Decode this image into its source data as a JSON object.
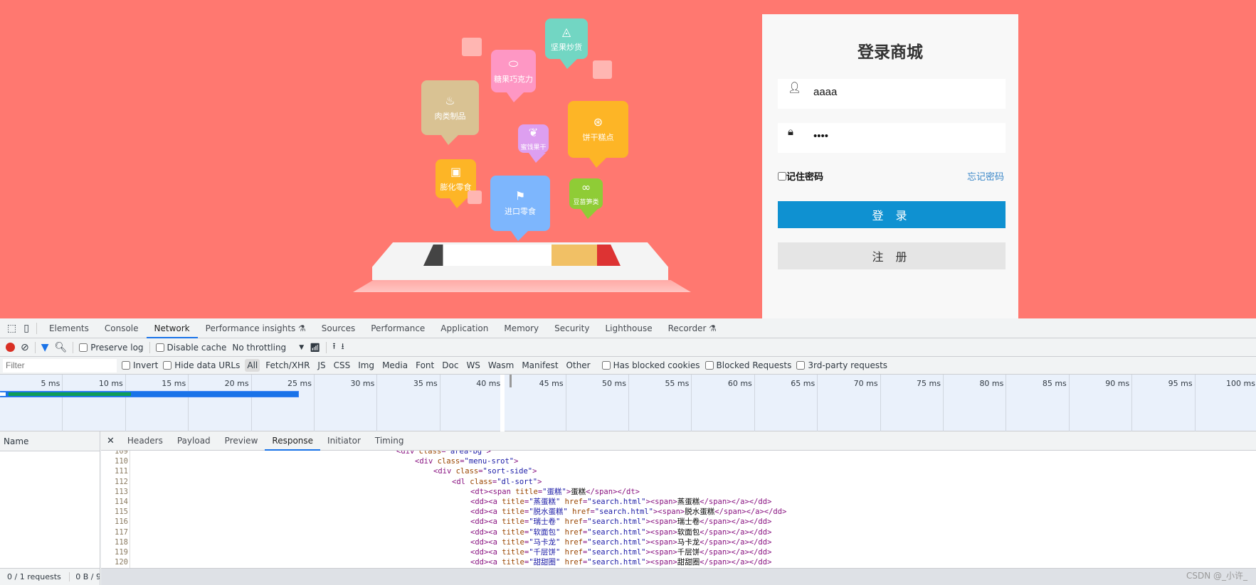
{
  "page": {
    "bg_color": "#ff7870",
    "categories": [
      {
        "label": "坚果炒货",
        "icon": "nut-icon",
        "color": "#72d6c3"
      },
      {
        "label": "糖果巧克力",
        "icon": "candy-icon",
        "color": "#fe97c4"
      },
      {
        "label": "肉类制品",
        "icon": "drumstick-icon",
        "color": "#d9c293"
      },
      {
        "label": "蜜饯果干",
        "icon": "cherry-icon",
        "color": "#dd9ff0"
      },
      {
        "label": "饼干糕点",
        "icon": "cookie-icon",
        "color": "#fdb526"
      },
      {
        "label": "膨化零食",
        "icon": "snack-bag-icon",
        "color": "#fdb526"
      },
      {
        "label": "进口零食",
        "icon": "flag-icon",
        "color": "#7db6fd"
      },
      {
        "label": "豆苗笋类",
        "icon": "sprout-icon",
        "color": "#8fcc36"
      }
    ]
  },
  "login": {
    "title": "登录商城",
    "username": "aaaa",
    "password": "aaaa",
    "remember": "记住密码",
    "forgot": "忘记密码",
    "login_btn": "登 录",
    "register_btn": "注 册",
    "accent": "#0f91d1"
  },
  "devtools": {
    "tabs": [
      "Elements",
      "Console",
      "Network",
      "Performance insights ⚗",
      "Sources",
      "Performance",
      "Application",
      "Memory",
      "Security",
      "Lighthouse",
      "Recorder ⚗"
    ],
    "active_tab": "Network",
    "toolbar": {
      "preserve_log": "Preserve log",
      "disable_cache": "Disable cache",
      "throttling": "No throttling"
    },
    "filter": {
      "placeholder": "Filter",
      "invert": "Invert",
      "hide_data_urls": "Hide data URLs",
      "types": [
        "All",
        "Fetch/XHR",
        "JS",
        "CSS",
        "Img",
        "Media",
        "Font",
        "Doc",
        "WS",
        "Wasm",
        "Manifest",
        "Other"
      ],
      "has_blocked_cookies": "Has blocked cookies",
      "blocked_requests": "Blocked Requests",
      "third_party": "3rd-party requests"
    },
    "timeline_ticks": [
      "5 ms",
      "10 ms",
      "15 ms",
      "20 ms",
      "25 ms",
      "30 ms",
      "35 ms",
      "40 ms",
      "45 ms",
      "50 ms",
      "55 ms",
      "60 ms",
      "65 ms",
      "70 ms",
      "75 ms",
      "80 ms",
      "85 ms",
      "90 ms",
      "95 ms",
      "100 ms"
    ],
    "name_header": "Name",
    "detail_tabs": [
      "Headers",
      "Payload",
      "Preview",
      "Response",
      "Initiator",
      "Timing"
    ],
    "active_detail_tab": "Response",
    "status": {
      "requests": "0 / 1 requests",
      "transferred": "0 B / 9"
    },
    "code_lines": [
      {
        "n": "109",
        "i": 0,
        "t": [
          [
            "tag",
            "<div "
          ],
          [
            "an",
            "class"
          ],
          [
            "tag",
            "="
          ],
          [
            "av",
            "\"area-bg\""
          ],
          [
            "tag",
            ">"
          ]
        ]
      },
      {
        "n": "110",
        "i": 1,
        "t": [
          [
            "tag",
            "<div "
          ],
          [
            "an",
            "class"
          ],
          [
            "tag",
            "="
          ],
          [
            "av",
            "\"menu-srot\""
          ],
          [
            "tag",
            ">"
          ]
        ]
      },
      {
        "n": "111",
        "i": 2,
        "t": [
          [
            "tag",
            "<div "
          ],
          [
            "an",
            "class"
          ],
          [
            "tag",
            "="
          ],
          [
            "av",
            "\"sort-side\""
          ],
          [
            "tag",
            ">"
          ]
        ]
      },
      {
        "n": "112",
        "i": 3,
        "t": [
          [
            "tag",
            "<dl "
          ],
          [
            "an",
            "class"
          ],
          [
            "tag",
            "="
          ],
          [
            "av",
            "\"dl-sort\""
          ],
          [
            "tag",
            ">"
          ]
        ]
      },
      {
        "n": "113",
        "i": 4,
        "t": [
          [
            "tag",
            "<dt><span "
          ],
          [
            "an",
            "title"
          ],
          [
            "tag",
            "="
          ],
          [
            "av",
            "\"蛋糕\""
          ],
          [
            "tag",
            ">"
          ],
          [
            "tx",
            "蛋糕"
          ],
          [
            "tag",
            "</span></dt>"
          ]
        ]
      },
      {
        "n": "114",
        "i": 4,
        "t": [
          [
            "tag",
            "<dd><a "
          ],
          [
            "an",
            "title"
          ],
          [
            "tag",
            "="
          ],
          [
            "av",
            "\"蒸蛋糕\" "
          ],
          [
            "an",
            "href"
          ],
          [
            "tag",
            "="
          ],
          [
            "av",
            "\"search.html\""
          ],
          [
            "tag",
            "><span>"
          ],
          [
            "tx",
            "蒸蛋糕"
          ],
          [
            "tag",
            "</span></a></dd>"
          ]
        ]
      },
      {
        "n": "115",
        "i": 4,
        "t": [
          [
            "tag",
            "<dd><a "
          ],
          [
            "an",
            "title"
          ],
          [
            "tag",
            "="
          ],
          [
            "av",
            "\"脱水蛋糕\" "
          ],
          [
            "an",
            "href"
          ],
          [
            "tag",
            "="
          ],
          [
            "av",
            "\"search.html\""
          ],
          [
            "tag",
            "><span>"
          ],
          [
            "tx",
            "脱水蛋糕"
          ],
          [
            "tag",
            "</span></a></dd>"
          ]
        ]
      },
      {
        "n": "116",
        "i": 4,
        "t": [
          [
            "tag",
            "<dd><a "
          ],
          [
            "an",
            "title"
          ],
          [
            "tag",
            "="
          ],
          [
            "av",
            "\"瑞士卷\" "
          ],
          [
            "an",
            "href"
          ],
          [
            "tag",
            "="
          ],
          [
            "av",
            "\"search.html\""
          ],
          [
            "tag",
            "><span>"
          ],
          [
            "tx",
            "瑞士卷"
          ],
          [
            "tag",
            "</span></a></dd>"
          ]
        ]
      },
      {
        "n": "117",
        "i": 4,
        "t": [
          [
            "tag",
            "<dd><a "
          ],
          [
            "an",
            "title"
          ],
          [
            "tag",
            "="
          ],
          [
            "av",
            "\"软面包\" "
          ],
          [
            "an",
            "href"
          ],
          [
            "tag",
            "="
          ],
          [
            "av",
            "\"search.html\""
          ],
          [
            "tag",
            "><span>"
          ],
          [
            "tx",
            "软面包"
          ],
          [
            "tag",
            "</span></a></dd>"
          ]
        ]
      },
      {
        "n": "118",
        "i": 4,
        "t": [
          [
            "tag",
            "<dd><a "
          ],
          [
            "an",
            "title"
          ],
          [
            "tag",
            "="
          ],
          [
            "av",
            "\"马卡龙\" "
          ],
          [
            "an",
            "href"
          ],
          [
            "tag",
            "="
          ],
          [
            "av",
            "\"search.html\""
          ],
          [
            "tag",
            "><span>"
          ],
          [
            "tx",
            "马卡龙"
          ],
          [
            "tag",
            "</span></a></dd>"
          ]
        ]
      },
      {
        "n": "119",
        "i": 4,
        "t": [
          [
            "tag",
            "<dd><a "
          ],
          [
            "an",
            "title"
          ],
          [
            "tag",
            "="
          ],
          [
            "av",
            "\"千层饼\" "
          ],
          [
            "an",
            "href"
          ],
          [
            "tag",
            "="
          ],
          [
            "av",
            "\"search.html\""
          ],
          [
            "tag",
            "><span>"
          ],
          [
            "tx",
            "千层饼"
          ],
          [
            "tag",
            "</span></a></dd>"
          ]
        ]
      },
      {
        "n": "120",
        "i": 4,
        "t": [
          [
            "tag",
            "<dd><a "
          ],
          [
            "an",
            "title"
          ],
          [
            "tag",
            "="
          ],
          [
            "av",
            "\"甜甜圈\" "
          ],
          [
            "an",
            "href"
          ],
          [
            "tag",
            "="
          ],
          [
            "av",
            "\"search.html\""
          ],
          [
            "tag",
            "><span>"
          ],
          [
            "tx",
            "甜甜圈"
          ],
          [
            "tag",
            "</span></a></dd>"
          ]
        ]
      }
    ]
  },
  "watermark": "CSDN @_小许_"
}
